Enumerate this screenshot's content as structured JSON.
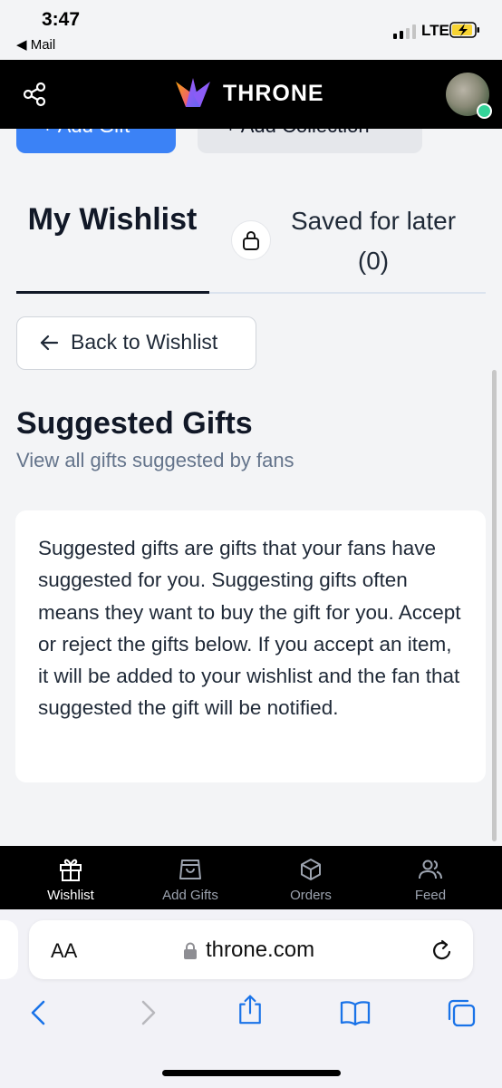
{
  "status_bar": {
    "time": "3:47",
    "back_app": "◀ Mail",
    "network": "LTE"
  },
  "header": {
    "brand": "THRONE",
    "partial_buttons": {
      "add_gift": "+ Add Gift",
      "add_collection": "+ Add Collection"
    }
  },
  "tabs": {
    "active": "My Wishlist",
    "saved": "Saved for later (0)"
  },
  "back_button": {
    "label": "Back to Wishlist"
  },
  "suggested": {
    "title": "Suggested Gifts",
    "subtitle": "View all gifts suggested by fans",
    "description": "Suggested gifts are gifts that your fans have suggested for you. Suggesting gifts often means they want to buy the gift for you. Accept or reject the gifts below. If you accept an item, it will be added to your wishlist and the fan that suggested the gift will be notified."
  },
  "bottom_nav": {
    "items": [
      {
        "label": "Wishlist",
        "icon": "gift-icon",
        "active": true
      },
      {
        "label": "Add Gifts",
        "icon": "shopping-bag-icon",
        "active": false
      },
      {
        "label": "Orders",
        "icon": "package-icon",
        "active": false
      },
      {
        "label": "Feed",
        "icon": "users-icon",
        "active": false
      }
    ]
  },
  "browser": {
    "text_size_label": "AA",
    "url": "throne.com"
  },
  "colors": {
    "accent_blue": "#3b82f6",
    "nav_bg": "#000000",
    "page_bg": "#f3f4f6",
    "online_green": "#34d399"
  }
}
